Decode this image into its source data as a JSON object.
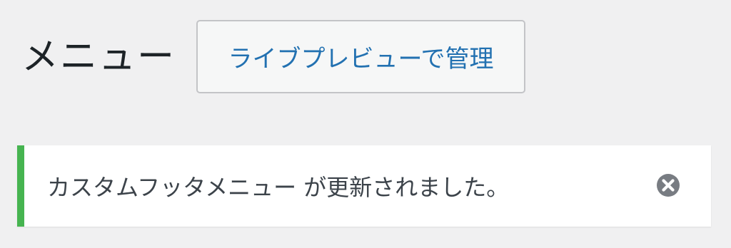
{
  "header": {
    "title": "メニュー",
    "live_preview_label": "ライブプレビューで管理"
  },
  "notice": {
    "message": "カスタムフッタメニュー が更新されました。",
    "status": "success",
    "accent_color": "#46b450",
    "dismiss_icon": "close-circle-icon"
  },
  "colors": {
    "background": "#f0f0f1",
    "link": "#2271b1",
    "text": "#1d2327"
  }
}
